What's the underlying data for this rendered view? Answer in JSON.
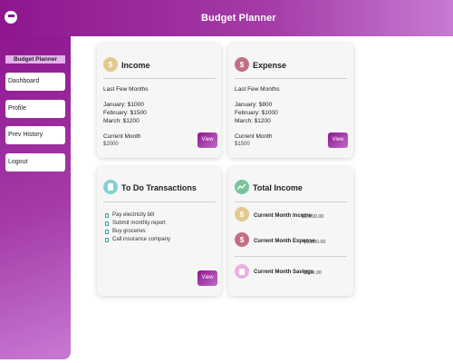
{
  "header": {
    "title": "Budget Planner",
    "menu_icon": "hamburger-icon"
  },
  "sidebar": {
    "brand": "Budget Planner",
    "items": [
      {
        "label": "Dashboard"
      },
      {
        "label": "Profile"
      },
      {
        "label": "Prev History"
      },
      {
        "label": "Logout"
      }
    ]
  },
  "income": {
    "title": "Income",
    "icon": "dollar-icon",
    "icon_color": "#e2c990",
    "subtitle": "Last Few Months",
    "months": [
      "January: $1000",
      "February: $1500",
      "March: $1200"
    ],
    "current_label": "Current Month",
    "current_value": "$2000",
    "view_label": "View"
  },
  "expense": {
    "title": "Expense",
    "icon": "dollar-icon",
    "icon_color": "#c26f83",
    "subtitle": "Last Few Months",
    "months": [
      "January: $800",
      "February: $1000",
      "March: $1200"
    ],
    "current_label": "Current Month",
    "current_value": "$1500",
    "view_label": "View"
  },
  "todo": {
    "title": "To Do Transactions",
    "icon": "clipboard-icon",
    "icon_color": "#7fd3d0",
    "items": [
      "Pay electricity bill",
      "Submit monthly report",
      "Buy groceries",
      "Call insurance company"
    ],
    "view_label": "View"
  },
  "total": {
    "title": "Total Income",
    "icon": "trend-icon",
    "icon_color": "#78c59a",
    "rows": [
      {
        "label": "Current Month Income",
        "value": "$2,000.00",
        "icon": "dollar-icon",
        "color": "#e2c990"
      },
      {
        "label": "Current Month Expense",
        "value": "$1,500.00",
        "icon": "dollar-icon",
        "color": "#c26f83"
      },
      {
        "label": "Current Month Savings",
        "value": "$500.00",
        "icon": "piggy-bank-icon",
        "color": "#ebb1df"
      }
    ]
  },
  "colors": {
    "accent": "#8e168f",
    "accent_light": "#c879d4"
  }
}
